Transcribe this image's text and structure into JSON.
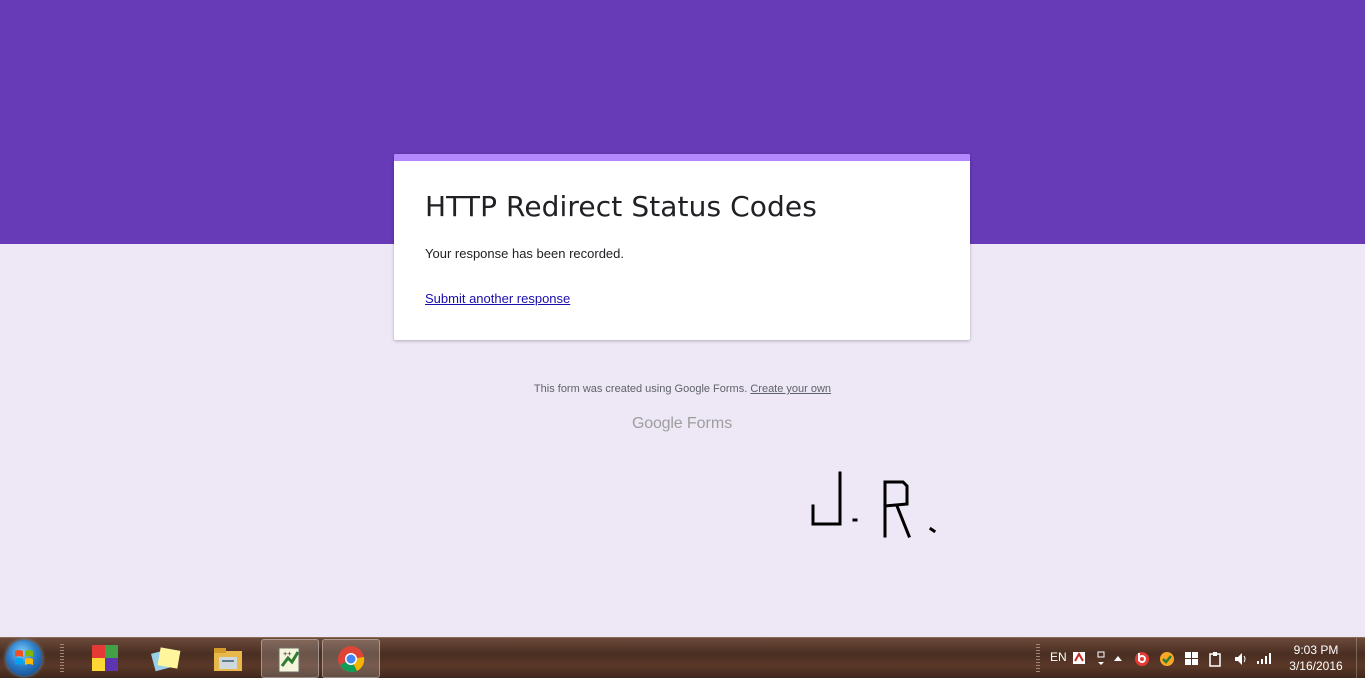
{
  "form": {
    "title": "HTTP Redirect Status Codes",
    "message": "Your response has been recorded.",
    "submit_another_label": "Submit another response"
  },
  "footer": {
    "created_text": "This form was created using Google Forms.",
    "create_own_label": "Create your own",
    "logo_google": "Google",
    "logo_forms": "Forms"
  },
  "signature": {
    "text": "J. R."
  },
  "colors": {
    "banner": "#673ab7",
    "accent": "#b388ff",
    "background": "#ede7f6",
    "link": "#1a0dab"
  },
  "taskbar": {
    "pinned": [
      {
        "icon": "microsoft-office-icon"
      },
      {
        "icon": "sticky-notes-icon"
      },
      {
        "icon": "file-explorer-icon"
      },
      {
        "icon": "notepad-plus-plus-icon"
      },
      {
        "icon": "chrome-icon"
      }
    ],
    "tray": {
      "language": "EN",
      "time": "9:03 PM",
      "date": "3/16/2016"
    }
  }
}
